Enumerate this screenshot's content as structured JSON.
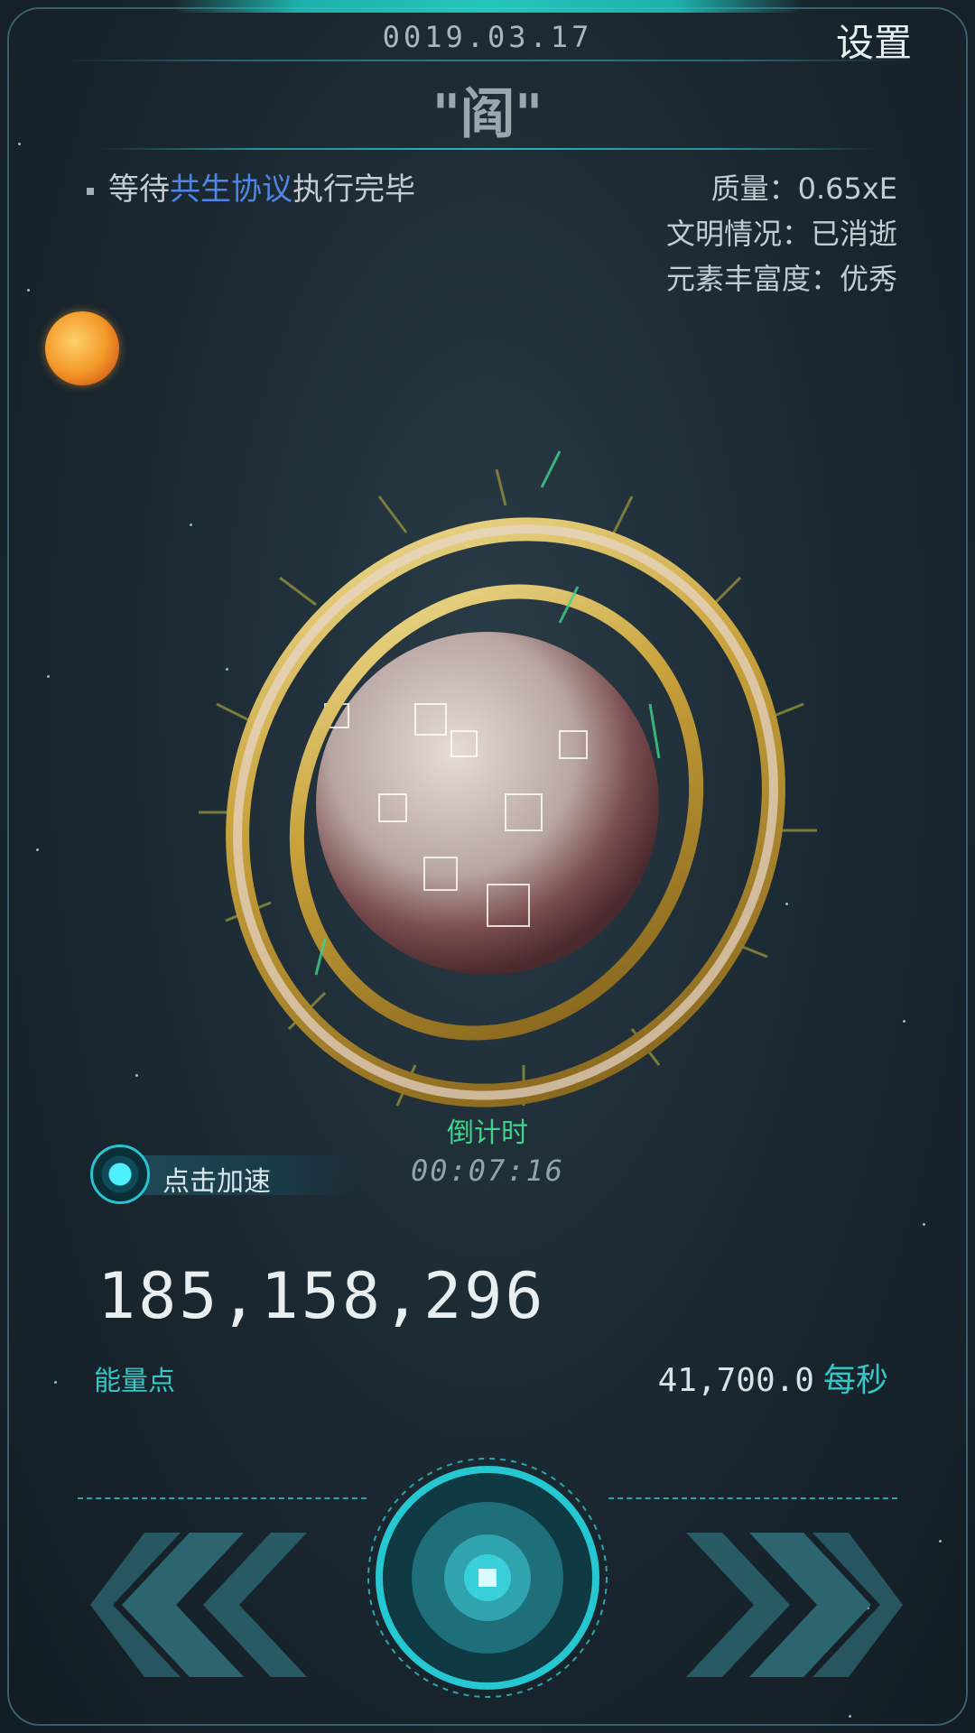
{
  "header": {
    "date": "0019.03.17",
    "settings_label": "设置",
    "planet_name": "\"阎\""
  },
  "task": {
    "prefix": "等待",
    "highlight": "共生协议",
    "suffix": "执行完毕"
  },
  "stats": [
    {
      "label": "质量：0.65xE"
    },
    {
      "label": "文明情况：已消逝"
    },
    {
      "label": "元素丰富度：优秀"
    }
  ],
  "countdown": {
    "label": "倒计时",
    "value": "00:07:16"
  },
  "speedup": {
    "label": "点击加速"
  },
  "energy": {
    "value": "185,158,296",
    "label": "能量点",
    "rate_value": "41,700.0",
    "rate_unit": "每秒"
  },
  "icons": {
    "sun": "sun-icon",
    "prev": "double-chevron-left-icon",
    "next": "double-chevron-right-icon",
    "center": "stop-icon"
  },
  "colors": {
    "accent": "#35c6c7",
    "highlight": "#4f86e6",
    "countdown": "#3fd48b",
    "background": "#1c2a33"
  }
}
